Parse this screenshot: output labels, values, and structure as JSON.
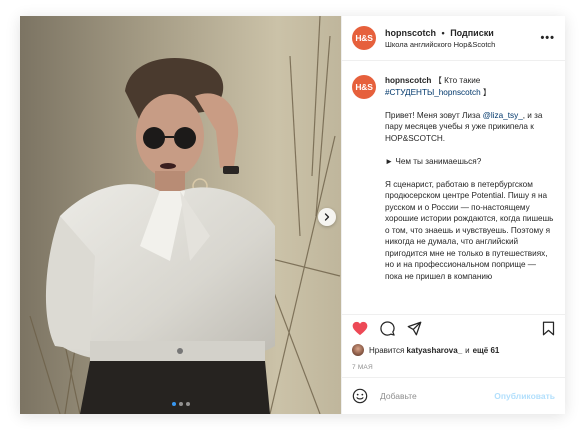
{
  "account": {
    "avatar_text": "H&S",
    "username": "hopnscotch",
    "follow_label": "Подписки",
    "subtitle": "Школа английского Hop&Scotch",
    "brand_color": "#e6603c"
  },
  "caption": {
    "username": "hopnscotch",
    "title_text": "【 Кто такие",
    "hashtag": "#СТУДЕНТЫ_hopnscotch",
    "title_end": "】",
    "p1_before": "Привет! Меня зовут Лиза ",
    "p1_mention": "@liza_tsy_",
    "p1_after": ", и за пару месяцев учебы я уже прикипела к HOP&SCOTCH.",
    "p2": "► Чем ты занимаешься?",
    "p3": "Я сценарист, работаю в петербургском продюсерском центре Potential. Пишу я на русском и о России — по-настоящему хорошие истории рождаются, когда пишешь о том, что знаешь и чувствуешь. Поэтому я никогда не думала, что английский пригодится мне не только в путешествиях, но и на профессиональном поприще — пока не пришел в компанию"
  },
  "likes": {
    "prefix": "Нравится",
    "user": "katyasharova_",
    "and": "и",
    "more": "ещё 61"
  },
  "date": "7 МАЯ",
  "comment": {
    "placeholder": "Добавьте",
    "publish_label": "Опубликовать"
  },
  "carousel": {
    "total": 3,
    "active_index": 0
  },
  "icons": {
    "like": "heart-icon",
    "comment": "comment-icon",
    "share": "send-icon",
    "save": "bookmark-icon",
    "emoji": "emoji-icon",
    "next": "chevron-right-icon",
    "more": "more-horizontal-icon"
  },
  "colors": {
    "like_active": "#ed4956",
    "link": "#00376b",
    "publish_disabled": "#b2dffc",
    "carousel_active": "#3897f0"
  }
}
